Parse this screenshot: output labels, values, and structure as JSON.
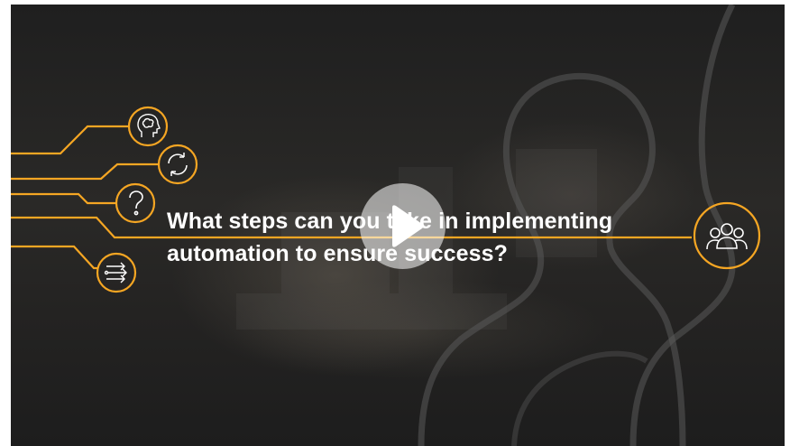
{
  "video": {
    "headline_line1": "What steps can you take in implementing",
    "headline_line2": "automation to ensure success?",
    "accent_color": "#f5a623",
    "text_color": "#ffffff"
  },
  "controls": {
    "play_button_icon": "play-icon"
  },
  "icons": [
    "brain-head-icon",
    "refresh-cycle-icon",
    "question-mark-icon",
    "arrows-flow-icon",
    "people-group-icon"
  ]
}
